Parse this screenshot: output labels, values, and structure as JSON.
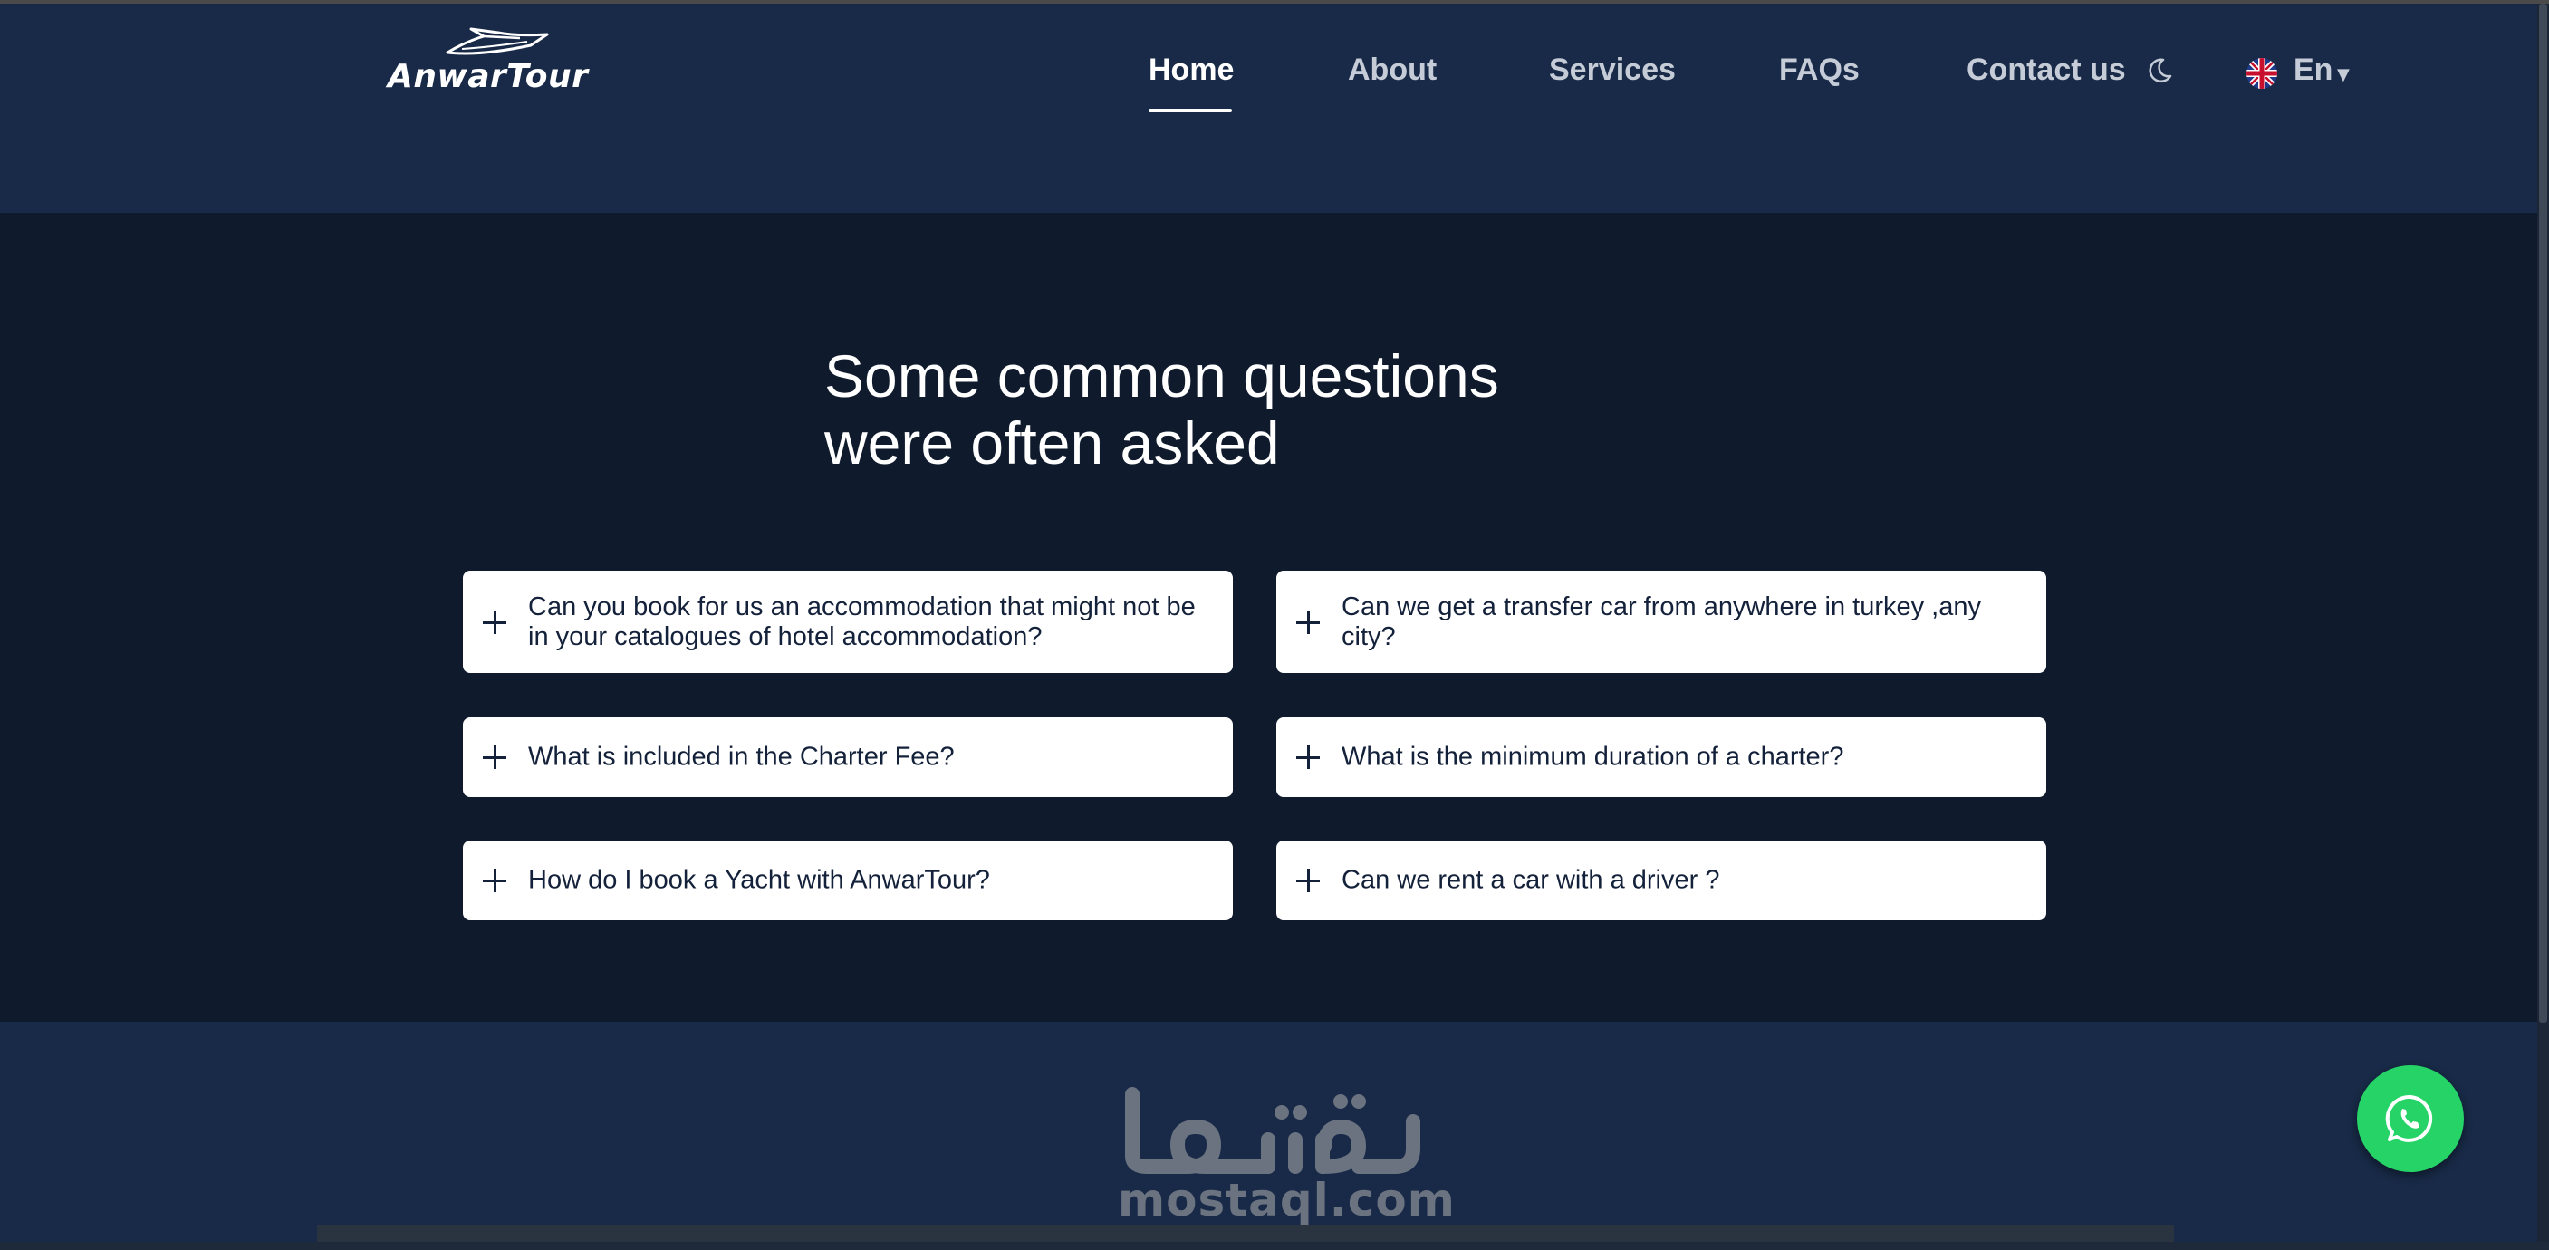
{
  "brand": {
    "name": "AnwarTour"
  },
  "nav": {
    "items": [
      {
        "label": "Home",
        "active": true
      },
      {
        "label": "About",
        "active": false
      },
      {
        "label": "Services",
        "active": false
      },
      {
        "label": "FAQs",
        "active": false
      },
      {
        "label": "Contact us",
        "active": false
      }
    ],
    "theme_icon": "moon-icon",
    "language": {
      "label": "En",
      "flag": "uk-flag-icon"
    }
  },
  "faq": {
    "title_line1": "Some common questions",
    "title_line2": "were often asked",
    "questions": [
      "Can you book for us an accommodation that might not be in your catalogues of hotel accommodation?",
      "Can we get a transfer car from anywhere in turkey ,any city?",
      "What is included in the Charter Fee?",
      "What is the minimum duration of a charter?",
      "How do I book a Yacht with AnwarTour?",
      "Can we rent a car with a driver ?"
    ]
  },
  "watermark": {
    "latin": "mostaql.com"
  },
  "whatsapp": {
    "icon": "whatsapp-icon"
  },
  "colors": {
    "header_bg": "#182a47",
    "section_bg": "#0f1b2d",
    "card_bg": "#ffffff",
    "card_text": "#14213a",
    "whatsapp_green": "#25d366"
  }
}
